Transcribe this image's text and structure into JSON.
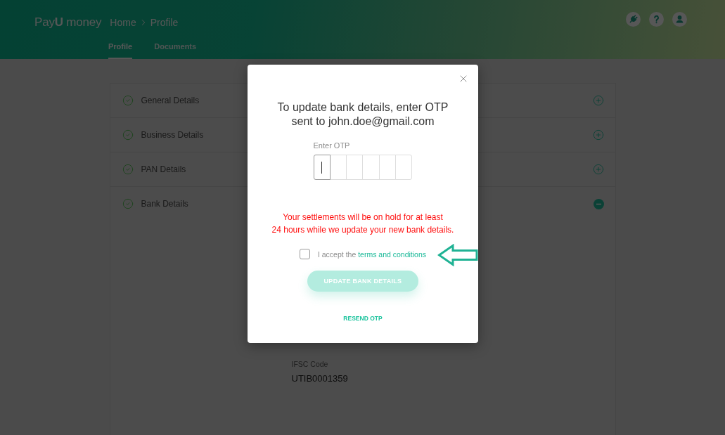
{
  "header": {
    "logo": "Pay**U** money",
    "breadcrumb": [
      {
        "label": "Home"
      },
      {
        "label": "Profile"
      }
    ],
    "tabs": [
      {
        "label": "Profile",
        "selected": true
      },
      {
        "label": "Documents",
        "selected": false
      }
    ]
  },
  "sections": [
    {
      "title": "General Details",
      "complete": true,
      "expanded": false
    },
    {
      "title": "Business Details",
      "complete": true,
      "expanded": false
    },
    {
      "title": "PAN Details",
      "complete": true,
      "expanded": false
    },
    {
      "title": "Bank Details",
      "complete": true,
      "expanded": true,
      "fields": [
        {
          "label": "IFSC Code",
          "value": "UTIB0001359"
        }
      ]
    }
  ],
  "modal": {
    "title": "To update bank details, enter OTP\nsent to john.doe@gmail.com",
    "otp": {
      "label": "Enter OTP",
      "cells": [
        {
          "focused": true
        },
        {
          "focused": false
        },
        {
          "focused": false
        },
        {
          "focused": false
        },
        {
          "focused": false
        },
        {
          "focused": false
        }
      ]
    },
    "warning": "Your settlements will be on hold for at least\n24 hours while we update your new bank details.",
    "terms": {
      "checked": false,
      "text": "I accept the",
      "link": "terms and conditions"
    },
    "submit": {
      "label": "UPDATE BANK DETAILS",
      "disabled": true
    },
    "resend": "RESEND OTP"
  }
}
